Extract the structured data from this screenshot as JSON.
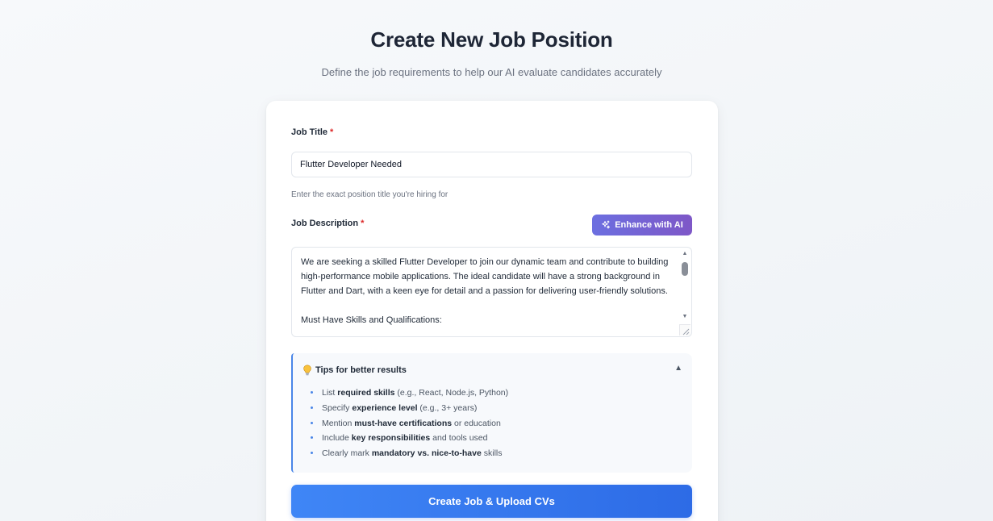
{
  "header": {
    "title": "Create New Job Position",
    "subtitle": "Define the job requirements to help our AI evaluate candidates accurately"
  },
  "form": {
    "job_title": {
      "label": "Job Title",
      "required_mark": "*",
      "value": "Flutter Developer Needed",
      "hint": "Enter the exact position title you're hiring for"
    },
    "job_description": {
      "label": "Job Description",
      "required_mark": "*",
      "enhance_label": "Enhance with AI",
      "value": "We are seeking a skilled Flutter Developer to join our dynamic team and contribute to building high-performance mobile applications. The ideal candidate will have a strong background in Flutter and Dart, with a keen eye for detail and a passion for delivering user-friendly solutions.\n\nMust Have Skills and Qualifications:"
    },
    "tips": {
      "title": "Tips for better results",
      "items": [
        {
          "pre": "List ",
          "bold": "required skills",
          "post": " (e.g., React, Node.js, Python)"
        },
        {
          "pre": "Specify ",
          "bold": "experience level",
          "post": " (e.g., 3+ years)"
        },
        {
          "pre": "Mention ",
          "bold": "must-have certifications",
          "post": " or education"
        },
        {
          "pre": "Include ",
          "bold": "key responsibilities",
          "post": " and tools used"
        },
        {
          "pre": "Clearly mark ",
          "bold": "mandatory vs. nice-to-have",
          "post": " skills"
        }
      ]
    },
    "submit_label": "Create Job & Upload CVs"
  },
  "colors": {
    "accent_blue": "#3f86f6",
    "enhance_gradient_start": "#6c6fe0",
    "enhance_gradient_end": "#7e57c7",
    "required": "#dc2626"
  },
  "icons": {
    "enhance": "sparkle-icon",
    "tips": "lightbulb-icon",
    "collapse": "chevron-up-icon"
  }
}
